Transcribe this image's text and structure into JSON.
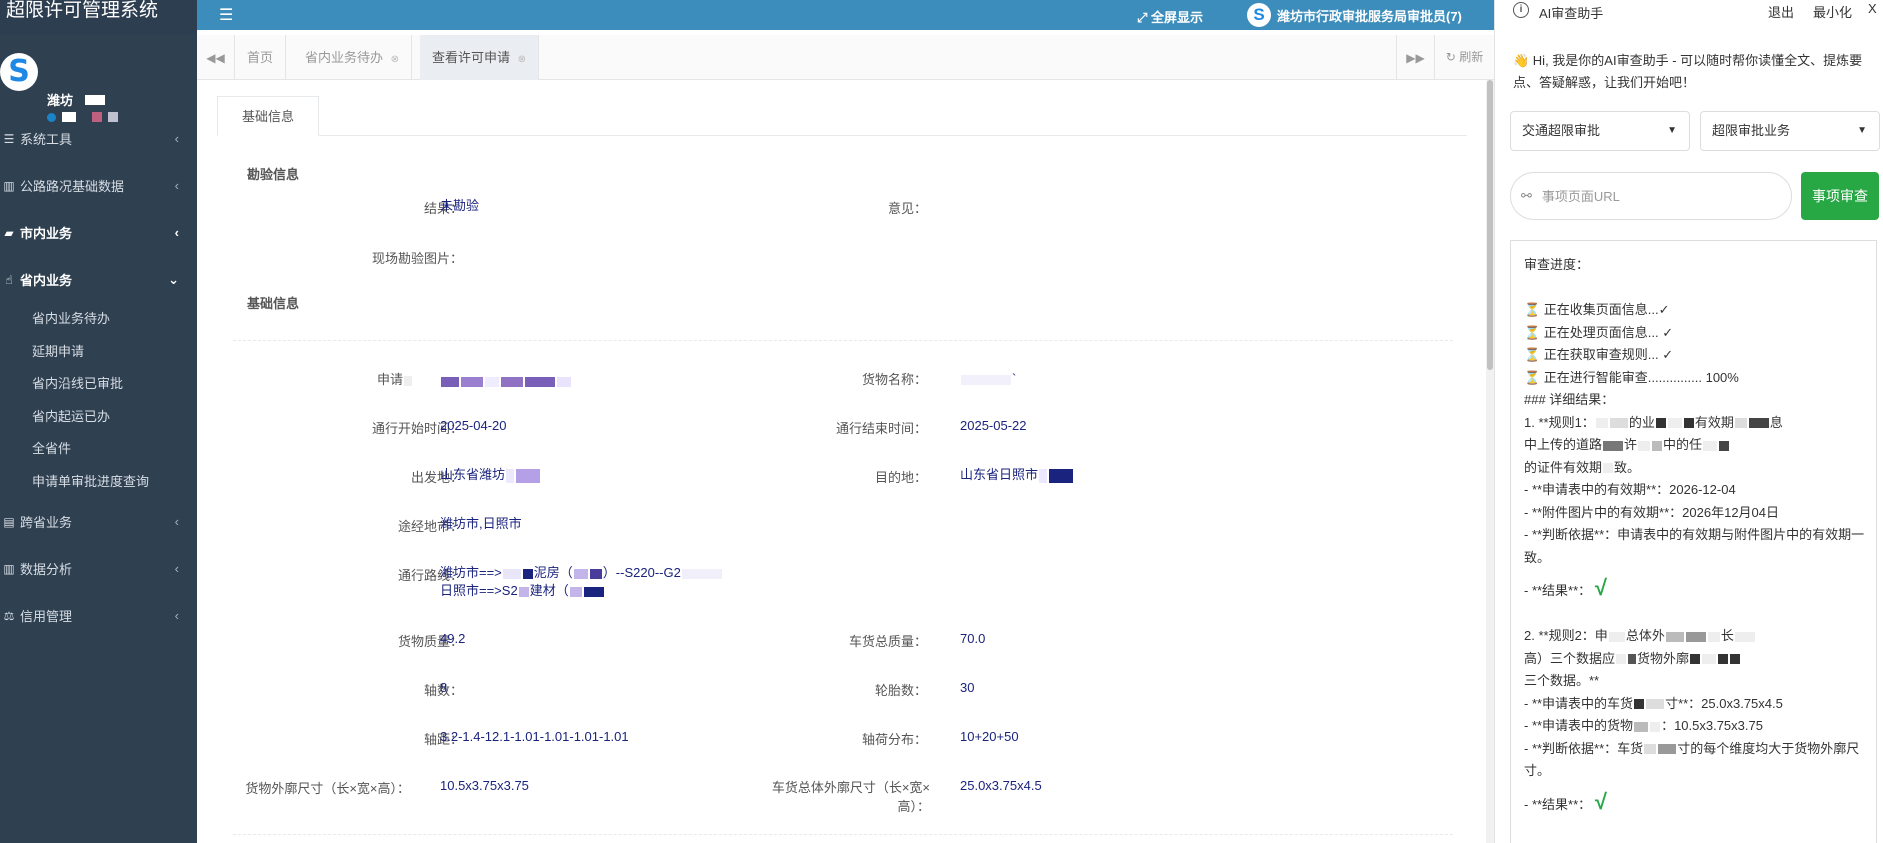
{
  "app": {
    "title": "超限许可管理系统",
    "fullscreen_label": "全屏显示",
    "user_org": "潍坊市行政审批服务局审批员(7)"
  },
  "sidebar": {
    "profile_name": "潍坊",
    "menu": [
      {
        "label": "系统工具",
        "icon": "list-icon",
        "expanded": false
      },
      {
        "label": "公路路况基础数据",
        "icon": "bar-chart-icon",
        "expanded": false
      },
      {
        "label": "市内业务",
        "icon": "truck-icon",
        "expanded": false,
        "active": true
      },
      {
        "label": "省内业务",
        "icon": "hand-pointer-icon",
        "expanded": true,
        "active": true
      },
      {
        "label": "跨省业务",
        "icon": "id-card-icon",
        "expanded": false
      },
      {
        "label": "数据分析",
        "icon": "bar-chart-icon",
        "expanded": false
      },
      {
        "label": "信用管理",
        "icon": "balance-scale-icon",
        "expanded": false
      }
    ],
    "submenu": [
      "省内业务待办",
      "延期申请",
      "省内沿线已审批",
      "省内起运已办",
      "全省件",
      "申请单审批进度查询"
    ]
  },
  "tabs": {
    "home": "首页",
    "todo": "省内业务待办",
    "current": "查看许可申请",
    "refresh": "刷新"
  },
  "content": {
    "tab_label": "基础信息",
    "survey_section": "勘验信息",
    "basic_section": "基础信息",
    "survey": {
      "result_label": "结果：",
      "result_value": "未勘验",
      "opinion_label": "意见：",
      "photo_label": "现场勘验图片："
    },
    "fields": {
      "applicant_label": "申请",
      "cargo_name_label": "货物名称：",
      "start_time_label": "通行开始时间：",
      "start_time_value": "2025-04-20",
      "end_time_label": "通行结束时间：",
      "end_time_value": "2025-05-22",
      "origin_label": "出发地：",
      "origin_value": "山东省潍坊",
      "destination_label": "目的地：",
      "destination_value": "山东省日照市",
      "via_label": "途经地市：",
      "via_value": "潍坊市,日照市",
      "route_label": "通行路线：",
      "route_line1_a": "潍坊市==>",
      "route_line1_b": "泥房（",
      "route_line1_c": "）--S220--G2",
      "route_line2_a": "日照市==>S2",
      "route_line2_b": "建材（",
      "cargo_mass_label": "货物质量：",
      "cargo_mass_value": "49.2",
      "total_mass_label": "车货总质量：",
      "total_mass_value": "70.0",
      "axles_label": "轴数：",
      "axles_value": "8",
      "tires_label": "轮胎数：",
      "tires_value": "30",
      "wheelbase_label": "轴距：",
      "wheelbase_value": "3.2-1.4-12.1-1.01-1.01-1.01-1.01",
      "axle_load_label": "轴荷分布：",
      "axle_load_value": "10+20+50",
      "cargo_dim_label": "货物外廓尺寸（长×宽×高）：",
      "cargo_dim_value": "10.5x3.75x3.75",
      "total_dim_label_1": "车货总体外廓尺寸（长×宽×",
      "total_dim_label_2": "高）：",
      "total_dim_value": "25.0x3.75x4.5"
    }
  },
  "ai": {
    "title": "AI审查助手",
    "logout": "退出",
    "minimize": "最小化",
    "close": "X",
    "greeting": "👋 Hi, 我是你的AI审查助手 - 可以随时帮你读懂全文、提炼要点、答疑解惑，让我们开始吧！",
    "select1": "交通超限审批",
    "select2": "超限审批业务",
    "url_placeholder": "事项页面URL",
    "check_button": "事项审查",
    "output": {
      "progress_title": "审查进度：",
      "step1": "⏳ 正在收集页面信息...✓",
      "step2": "⏳ 正在处理页面信息... ✓",
      "step3": "⏳ 正在获取审查规则... ✓",
      "step4": "⏳ 正在进行智能审查............... 100%",
      "detail_heading": "### 详细结果：",
      "rule1_a": "1. **规则1：",
      "rule1_b": "的业",
      "rule1_c": "有效期",
      "rule1_d": "息",
      "rule1_line2_a": "中上传的道路",
      "rule1_line2_b": "许",
      "rule1_line2_c": "中的任",
      "rule1_line3": "的证件有效期",
      "rule1_line3_b": "致。",
      "rule1_apply": "- **申请表中的有效期**：2026-12-04",
      "rule1_attach": "- **附件图片中的有效期**：2026年12月04日",
      "rule1_basis": "- **判断依据**：申请表中的有效期与附件图片中的有效期一致。",
      "result_label": "- **结果**：",
      "result_mark": "√",
      "rule2_a": "2. **规则2：申",
      "rule2_b": "总体外",
      "rule2_c": "长",
      "rule2_line2_a": "高）三个数据应",
      "rule2_line2_b": "货物外廓",
      "rule2_line3": "三个数据。**",
      "rule2_total_a": "- **申请表中的车货",
      "rule2_total_b": "寸**：25.0x3.75x4.5",
      "rule2_cargo_a": "- **申请表中的货物",
      "rule2_cargo_b": "：10.5x3.75x3.75",
      "rule2_basis_a": "- **判断依据**：车货",
      "rule2_basis_b": "寸的每个维度均大于货物外廓尺寸。",
      "result2_label": "- **结果**：",
      "result2_mark": "√"
    }
  },
  "colors": {
    "sidebar_bg": "#2f4050",
    "topbar_bg": "#3c8dbc",
    "value_text": "#1a237e",
    "success_green": "#28a745"
  }
}
